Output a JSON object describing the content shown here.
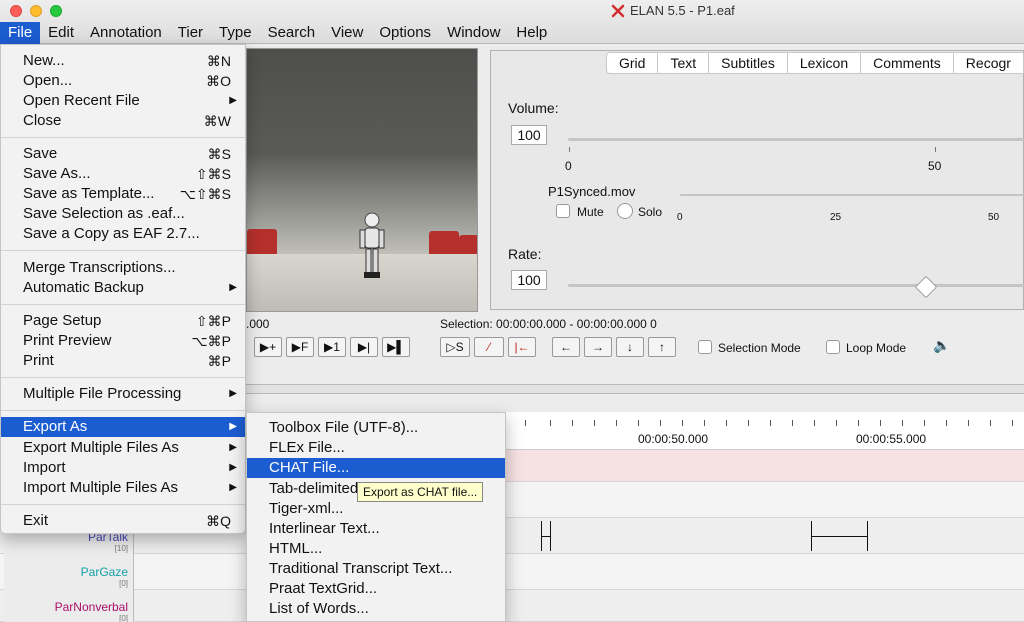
{
  "window": {
    "title": "ELAN 5.5 - P1.eaf"
  },
  "menubar": [
    "File",
    "Edit",
    "Annotation",
    "Tier",
    "Type",
    "Search",
    "View",
    "Options",
    "Window",
    "Help"
  ],
  "tabs": [
    "Grid",
    "Text",
    "Subtitles",
    "Lexicon",
    "Comments",
    "Recogr"
  ],
  "volume": {
    "label": "Volume:",
    "value": "100",
    "tick_0": "0",
    "tick_50": "50"
  },
  "media": {
    "file": "P1Synced.mov",
    "mute": "Mute",
    "solo": "Solo",
    "tick_0": "0",
    "tick_25": "25",
    "tick_50": "50"
  },
  "rate": {
    "label": "Rate:",
    "value": "100",
    "fraction": 0.98
  },
  "controls": {
    "time": ".000",
    "selection": "Selection: 00:00:00.000 - 00:00:00.000  0",
    "selection_mode": "Selection Mode",
    "loop_mode": "Loop Mode",
    "btn_s": "S",
    "btn_f": "F",
    "btn_1": "1"
  },
  "ruler": {
    "t1": "00:00:50.000",
    "t2": "00:00:55.000"
  },
  "tiers": [
    {
      "name": "ParTalk",
      "count": "[10]"
    },
    {
      "name": "ParGaze",
      "count": "[0]"
    },
    {
      "name": "ParNonverbal",
      "count": "[0]"
    }
  ],
  "file_menu": {
    "new": "New...",
    "new_sc": "⌘N",
    "open": "Open...",
    "open_sc": "⌘O",
    "open_recent": "Open Recent File",
    "close": "Close",
    "close_sc": "⌘W",
    "save": "Save",
    "save_sc": "⌘S",
    "save_as": "Save As...",
    "save_as_sc": "⇧⌘S",
    "save_template": "Save as Template...",
    "save_template_sc": "⌥⇧⌘S",
    "save_selection": "Save Selection as .eaf...",
    "save_copy": "Save a Copy as EAF 2.7...",
    "merge": "Merge Transcriptions...",
    "backup": "Automatic Backup",
    "page_setup": "Page Setup",
    "page_setup_sc": "⇧⌘P",
    "print_preview": "Print Preview",
    "print_preview_sc": "⌥⌘P",
    "print": "Print",
    "print_sc": "⌘P",
    "multiple": "Multiple File Processing",
    "export_as": "Export As",
    "export_multiple": "Export Multiple Files As",
    "import": "Import",
    "import_multiple": "Import Multiple Files As",
    "exit": "Exit",
    "exit_sc": "⌘Q"
  },
  "export_menu": [
    "Toolbox File (UTF-8)...",
    "FLEx File...",
    "CHAT File...",
    "Tab-delimited Text...",
    "Tiger-xml...",
    "Interlinear Text...",
    "HTML...",
    "Traditional Transcript Text...",
    "Praat TextGrid...",
    "List of Words..."
  ],
  "tooltip": "Export as CHAT file...",
  "colors": {
    "highlight": "#1c5cd1",
    "tier_label": "#4a4ab8",
    "tier_label_2": "#16a0a8",
    "tier_label_3": "#a8106a"
  }
}
